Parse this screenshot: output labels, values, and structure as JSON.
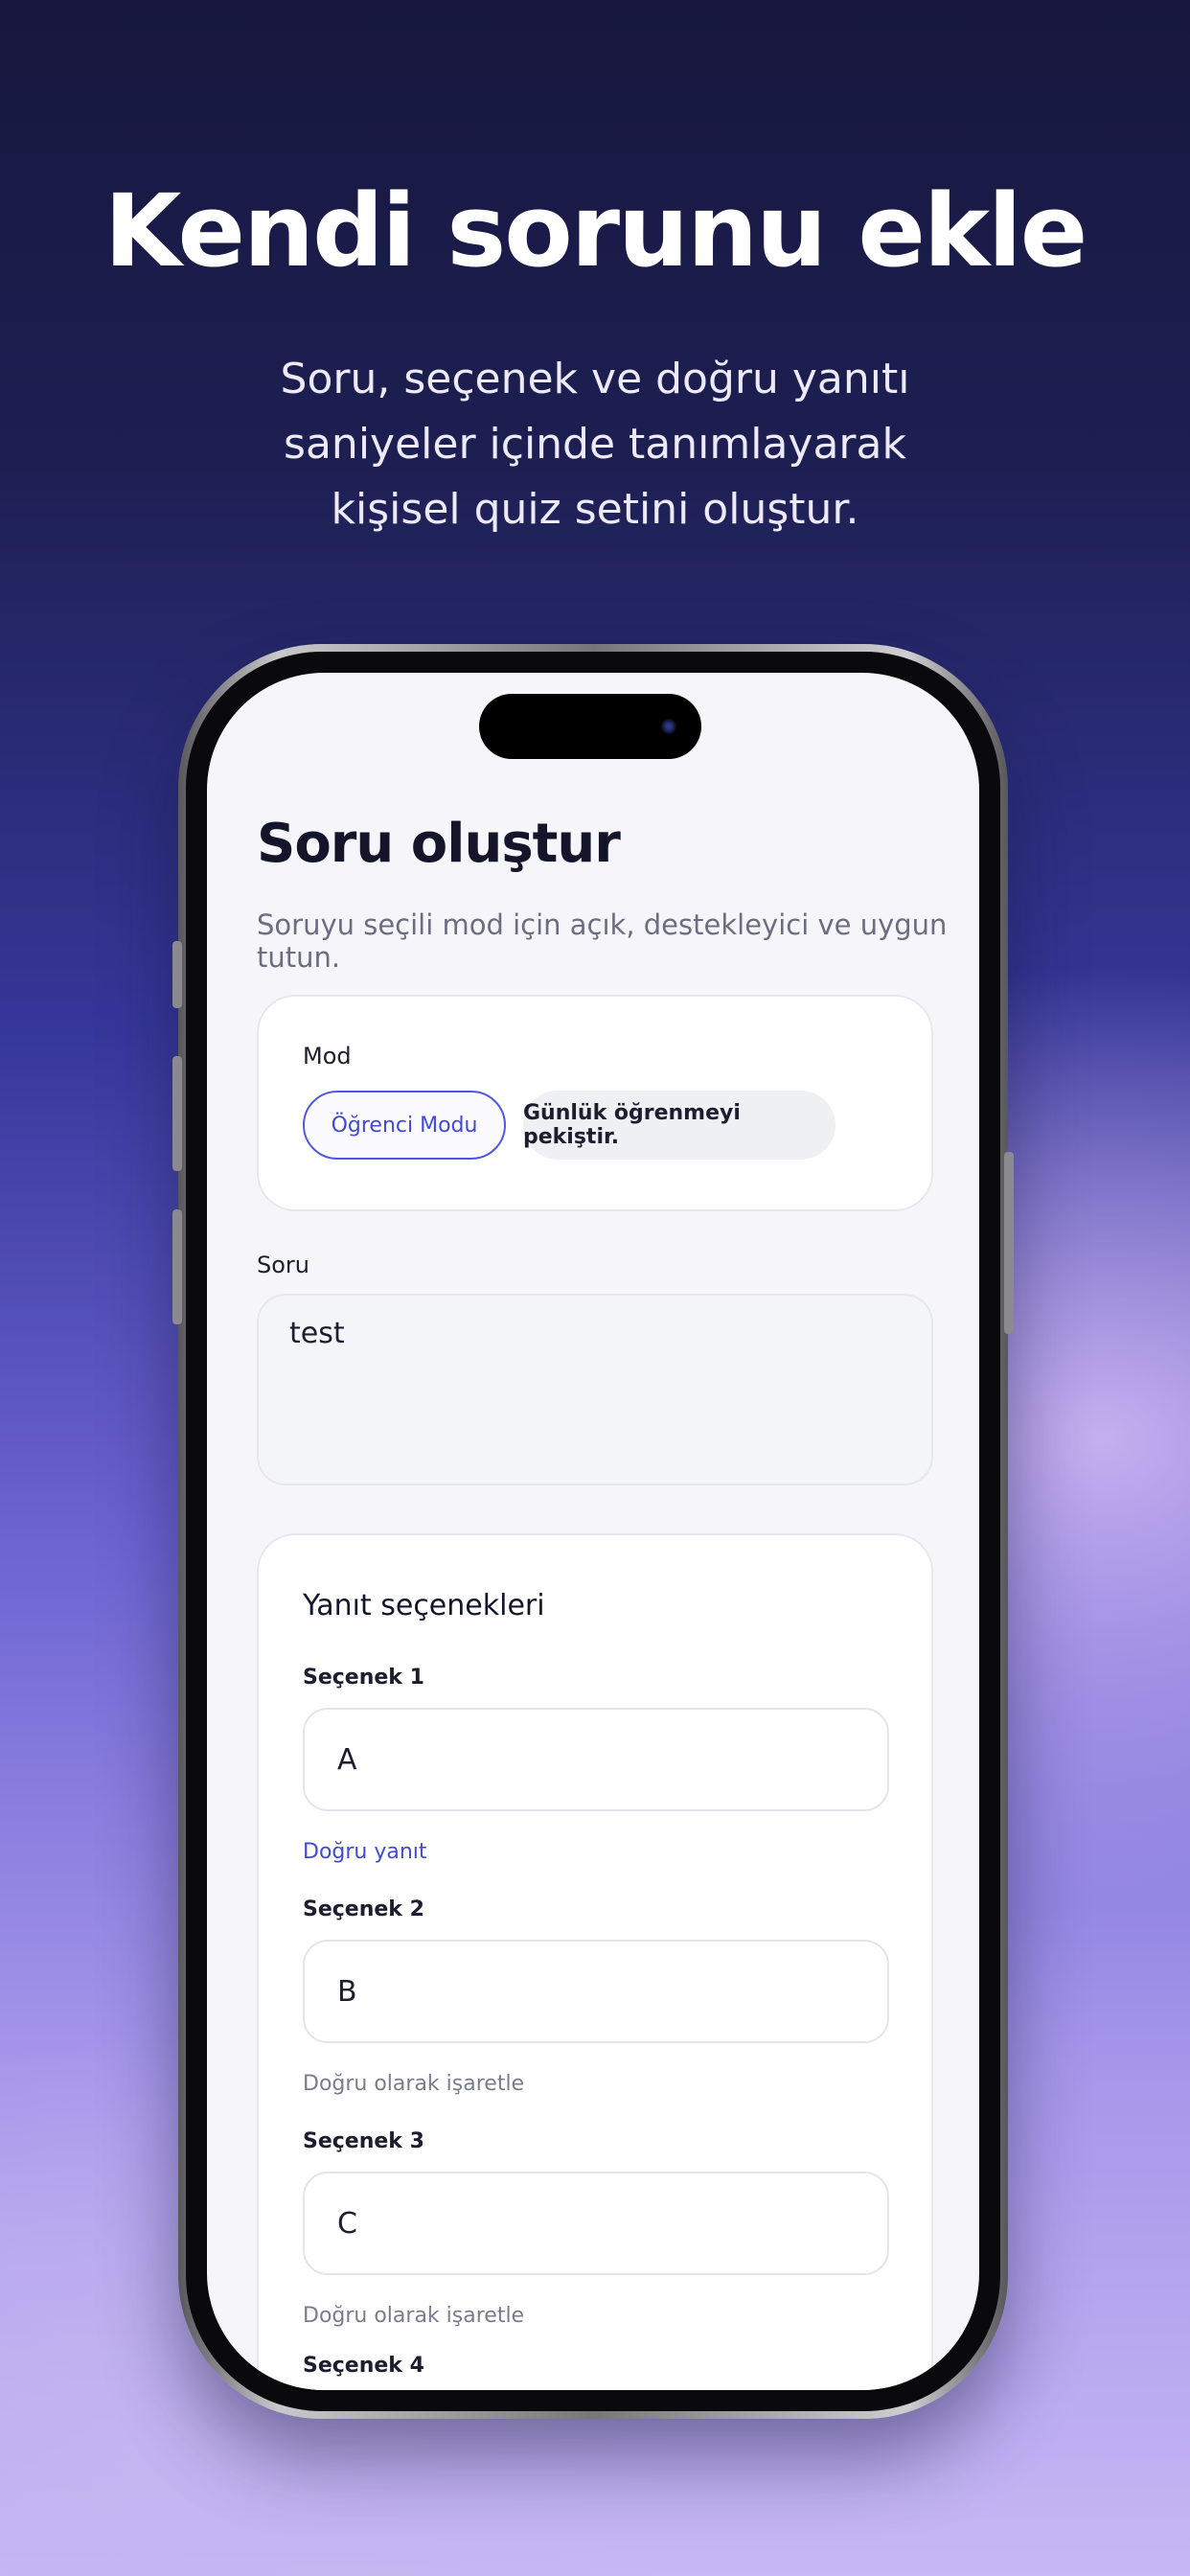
{
  "promo": {
    "headline": "Kendi sorunu ekle",
    "subhead": "Soru, seçenek ve doğru yanıtı saniyeler içinde tanımlayarak kişisel quiz setini oluştur."
  },
  "screen": {
    "title": "Soru oluştur",
    "description": "Soruyu seçili mod için açık, destekleyici ve uygun tutun.",
    "mode": {
      "label": "Mod",
      "selected": "Öğrenci Modu",
      "hint": "Günlük öğrenmeyi pekiştir."
    },
    "question": {
      "label": "Soru",
      "value": "test"
    },
    "answers": {
      "title": "Yanıt seçenekleri",
      "options": [
        {
          "label": "Seçenek 1",
          "value": "A",
          "status": "Doğru yanıt"
        },
        {
          "label": "Seçenek 2",
          "value": "B",
          "status": "Doğru olarak işaretle"
        },
        {
          "label": "Seçenek 3",
          "value": "C",
          "status": "Doğru olarak işaretle"
        },
        {
          "label": "Seçenek 4"
        }
      ]
    }
  },
  "colors": {
    "accent": "#4a52e0",
    "title": "#14152b",
    "muted": "#6b6d80"
  }
}
